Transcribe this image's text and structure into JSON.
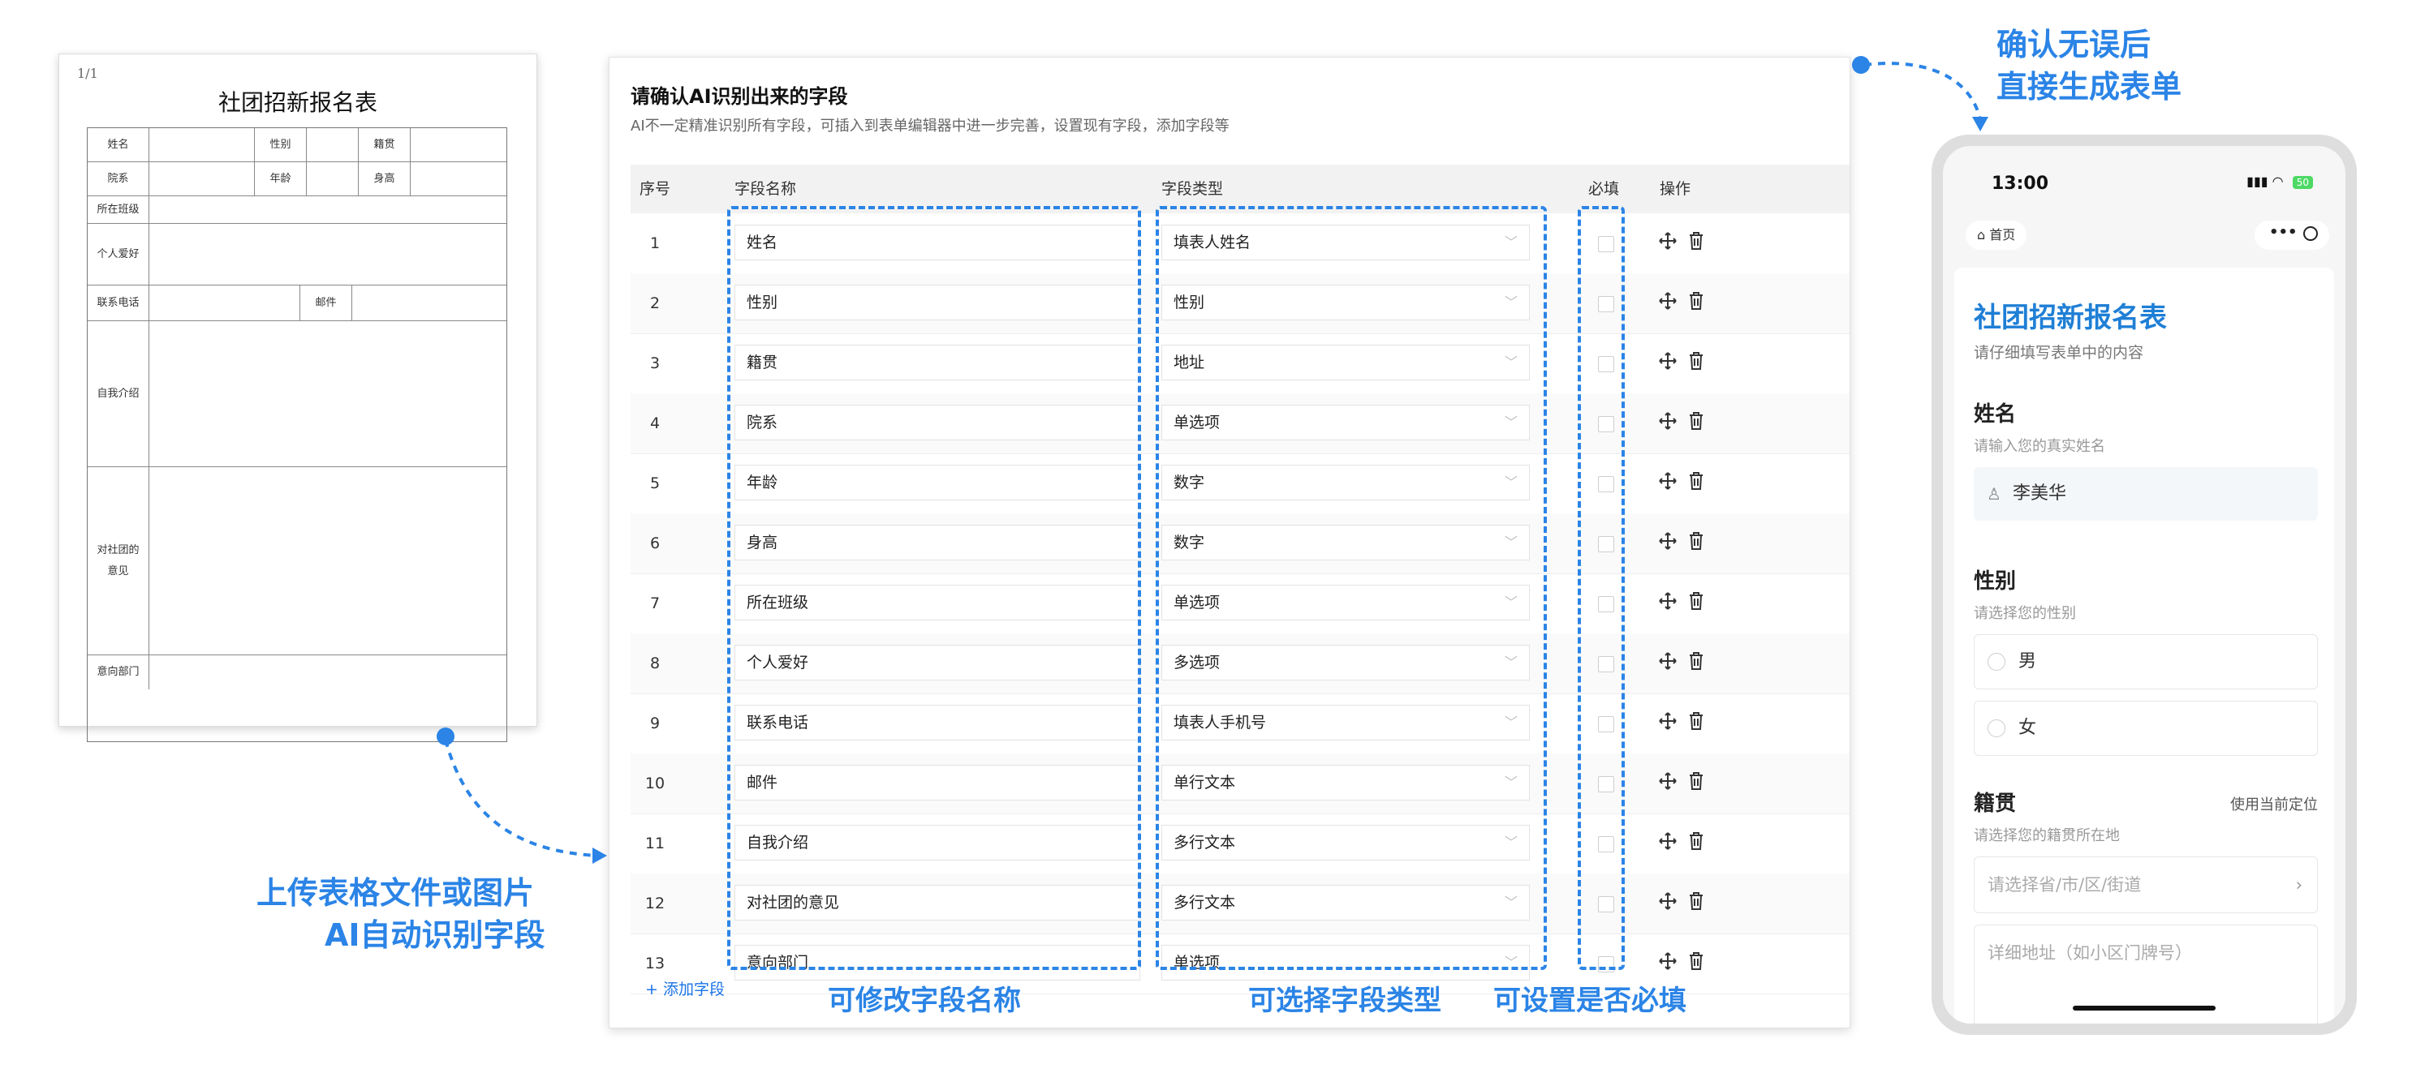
{
  "paper": {
    "page": "1/1",
    "title": "社团招新报名表",
    "labels": {
      "name": "姓名",
      "gender": "性别",
      "hometown": "籍贯",
      "college": "院系",
      "age": "年龄",
      "height": "身高",
      "class": "所在班级",
      "hobby": "个人爱好",
      "phone": "联系电话",
      "email": "邮件",
      "intro": "自我介绍",
      "opinion_1": "对社团的",
      "opinion_2": "意见",
      "dept": "意向部门"
    }
  },
  "panel": {
    "title": "请确认AI识别出来的字段",
    "subtitle": "AI不一定精准识别所有字段，可插入到表单编辑器中进一步完善，设置现有字段，添加字段等",
    "headers": {
      "index": "序号",
      "name": "字段名称",
      "type": "字段类型",
      "required": "必填",
      "actions": "操作"
    },
    "rows": [
      {
        "index": "1",
        "name": "姓名",
        "type": "填表人姓名"
      },
      {
        "index": "2",
        "name": "性别",
        "type": "性别"
      },
      {
        "index": "3",
        "name": "籍贯",
        "type": "地址"
      },
      {
        "index": "4",
        "name": "院系",
        "type": "单选项"
      },
      {
        "index": "5",
        "name": "年龄",
        "type": "数字"
      },
      {
        "index": "6",
        "name": "身高",
        "type": "数字"
      },
      {
        "index": "7",
        "name": "所在班级",
        "type": "单选项"
      },
      {
        "index": "8",
        "name": "个人爱好",
        "type": "多选项"
      },
      {
        "index": "9",
        "name": "联系电话",
        "type": "填表人手机号"
      },
      {
        "index": "10",
        "name": "邮件",
        "type": "单行文本"
      },
      {
        "index": "11",
        "name": "自我介绍",
        "type": "多行文本"
      },
      {
        "index": "12",
        "name": "对社团的意见",
        "type": "多行文本"
      },
      {
        "index": "13",
        "name": "意向部门",
        "type": "单选项"
      }
    ],
    "add_field": "+ 添加字段"
  },
  "callouts": {
    "upload_1": "上传表格文件或图片",
    "upload_2": "AI自动识别字段",
    "edit_name": "可修改字段名称",
    "select_type": "可选择字段类型",
    "set_required": "可设置是否必填",
    "confirm_1": "确认无误后",
    "confirm_2": "直接生成表单"
  },
  "phone": {
    "time": "13:00",
    "battery": "50",
    "home": "首页",
    "form_title": "社团招新报名表",
    "form_subtitle": "请仔细填写表单中的内容",
    "q_name": "姓名",
    "q_name_hint": "请输入您的真实姓名",
    "q_name_value": "李美华",
    "q_gender": "性别",
    "q_gender_hint": "请选择您的性别",
    "opt_male": "男",
    "opt_female": "女",
    "q_hometown": "籍贯",
    "locate": "使用当前定位",
    "q_hometown_hint": "请选择您的籍贯所在地",
    "region_placeholder": "请选择省/市/区/街道",
    "address_placeholder": "详细地址（如小区门牌号）"
  },
  "colors": {
    "accent": "#2b84e6",
    "form_title": "#1f7fd6"
  }
}
